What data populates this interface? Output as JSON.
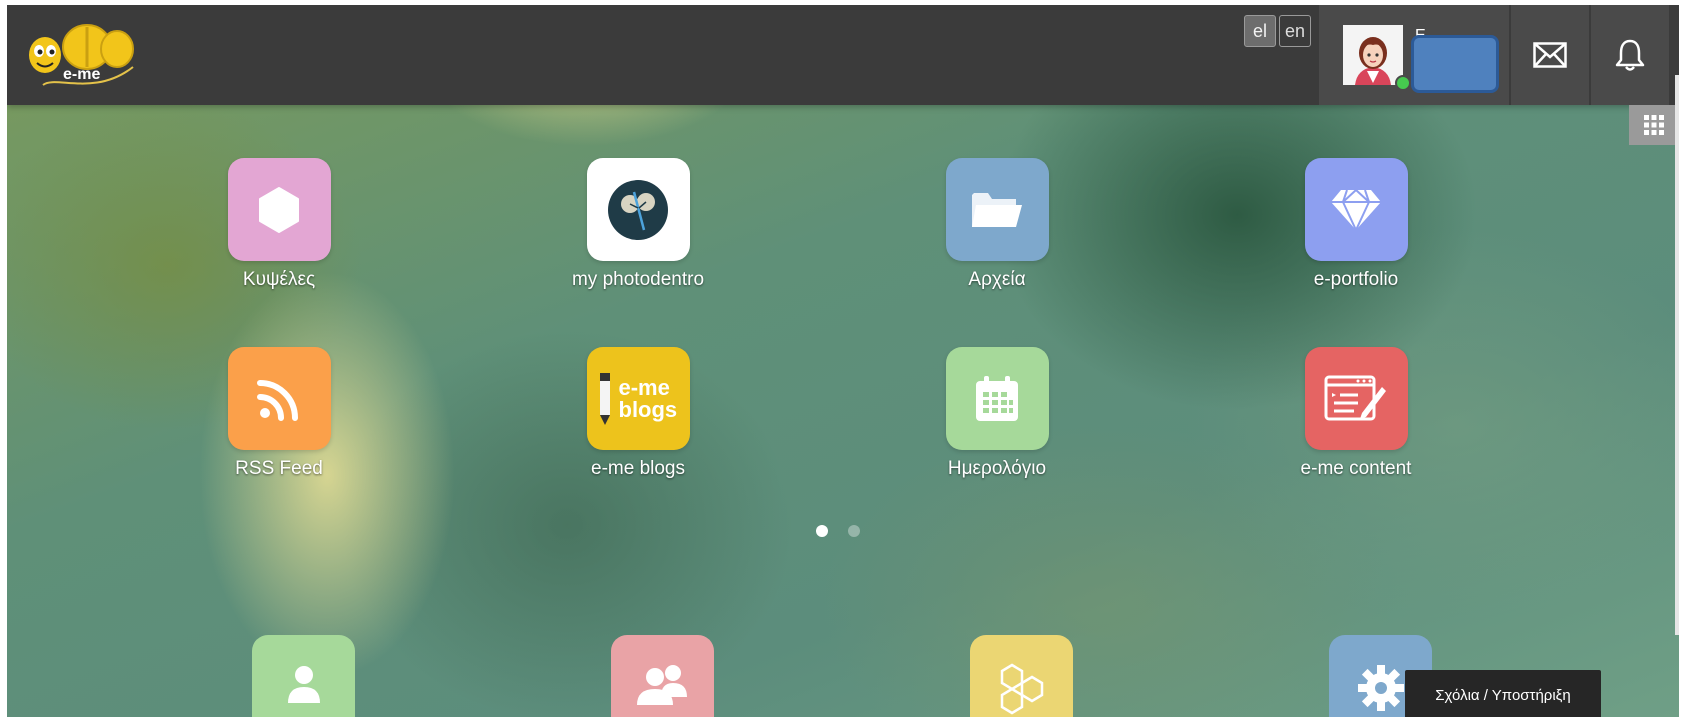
{
  "header": {
    "logo_text": "e-me",
    "lang_el": "el",
    "lang_en": "en",
    "user_name": "Ε"
  },
  "apps": [
    {
      "label": "Κυψέλες",
      "color": "#e3a6d3",
      "icon": "hive-hexagon-icon"
    },
    {
      "label": "my photodentro",
      "color": "#ffffff",
      "icon": "photodentro-icon"
    },
    {
      "label": "Αρχεία",
      "color": "#7ea8cc",
      "icon": "folder-icon"
    },
    {
      "label": "e-portfolio",
      "color": "#8d9ff0",
      "icon": "diamond-icon"
    },
    {
      "label": "RSS Feed",
      "color": "#fba04a",
      "icon": "rss-icon"
    },
    {
      "label": "e-me blogs",
      "color": "#edc31c",
      "icon": "blogs-icon",
      "tile_text_1": "e-me",
      "tile_text_2": "blogs"
    },
    {
      "label": "Ημερολόγιο",
      "color": "#a6d99a",
      "icon": "calendar-icon"
    },
    {
      "label": "e-me content",
      "color": "#e56463",
      "icon": "content-editor-icon"
    }
  ],
  "pager": {
    "pages": 2,
    "active": 1
  },
  "dock": [
    {
      "color": "#a6d99a",
      "icon": "user-icon"
    },
    {
      "color": "#e9a3a6",
      "icon": "users-icon"
    },
    {
      "color": "#ebd673",
      "icon": "honeycomb-icon"
    },
    {
      "color": "#7ea8cc",
      "icon": "gear-icon"
    }
  ],
  "tooltip": "Σχόλια / Υποστήριξη"
}
